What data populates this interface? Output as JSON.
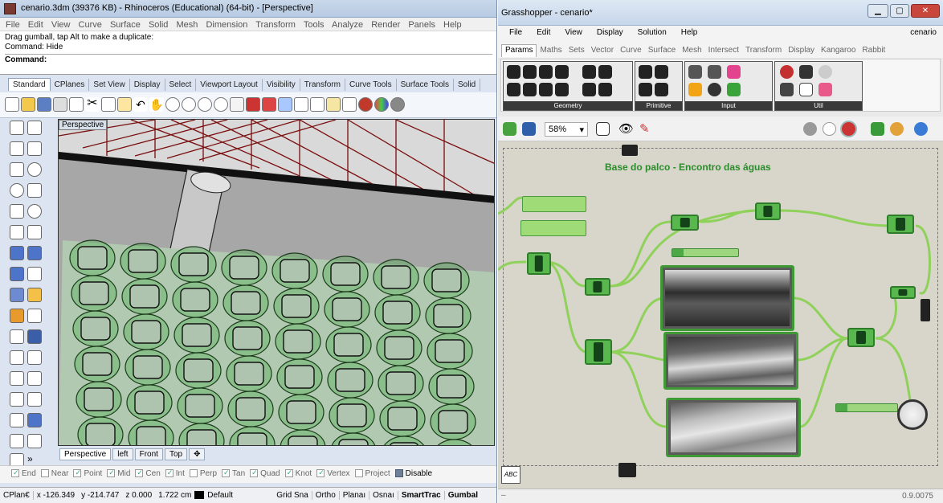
{
  "rhino": {
    "title": "cenario.3dm (39376 KB) - Rhinoceros (Educational) (64-bit) - [Perspective]",
    "menu": [
      "File",
      "Edit",
      "View",
      "Curve",
      "Surface",
      "Solid",
      "Mesh",
      "Dimension",
      "Transform",
      "Tools",
      "Analyze",
      "Render",
      "Panels",
      "Help"
    ],
    "command_history": [
      "Drag gumball, tap Alt to make a duplicate:",
      "Command: Hide"
    ],
    "command_prompt": "Command:",
    "toolbar_tabs": [
      "Standard",
      "CPlanes",
      "Set View",
      "Display",
      "Select",
      "Viewport Layout",
      "Visibility",
      "Transform",
      "Curve Tools",
      "Surface Tools",
      "Solid"
    ],
    "viewport_label": "Perspective",
    "viewport_tabs": [
      "Perspective",
      "left",
      "Front",
      "Top"
    ],
    "osnaps": [
      {
        "label": "End",
        "checked": true
      },
      {
        "label": "Near",
        "checked": false
      },
      {
        "label": "Point",
        "checked": true
      },
      {
        "label": "Mid",
        "checked": true
      },
      {
        "label": "Cen",
        "checked": true
      },
      {
        "label": "Int",
        "checked": true
      },
      {
        "label": "Perp",
        "checked": false
      },
      {
        "label": "Tan",
        "checked": true
      },
      {
        "label": "Quad",
        "checked": true
      },
      {
        "label": "Knot",
        "checked": true
      },
      {
        "label": "Vertex",
        "checked": true
      },
      {
        "label": "Project",
        "checked": false
      },
      {
        "label": "Disable",
        "checked": false
      }
    ],
    "status": {
      "cplane": "CPlan€",
      "x": "x -126.349",
      "y": "y -214.747",
      "z": "z 0.000",
      "distance": "1.722 cm",
      "layer": "Default",
      "grid_snap": "Grid Sna",
      "ortho": "Ortho",
      "planar": "Planaı",
      "osnap": "Osnaı",
      "smarttrack": "SmartTrac",
      "gumball": "Gumbal"
    },
    "colors": {
      "mesh_red": "#8a1818",
      "grid_green": "#3aa83a",
      "layer_swatch": "#000000"
    }
  },
  "grasshopper": {
    "title": "Grasshopper - cenario*",
    "menu": [
      "File",
      "Edit",
      "View",
      "Display",
      "Solution",
      "Help"
    ],
    "document_name": "cenario",
    "tabs": [
      "Params",
      "Maths",
      "Sets",
      "Vector",
      "Curve",
      "Surface",
      "Mesh",
      "Intersect",
      "Transform",
      "Display",
      "Kangaroo",
      "Rabbit"
    ],
    "ribbon_groups": [
      "Geometry",
      "Primitive",
      "Input",
      "Util"
    ],
    "zoom": "58%",
    "canvas_title": "Base do palco - Encontro das águas",
    "version": "0.9.0075",
    "colors": {
      "node_green": "#58b84d",
      "wire_green": "#8fd15a",
      "canvas": "#d8d6cb",
      "title_green": "#2a8c2a"
    }
  }
}
